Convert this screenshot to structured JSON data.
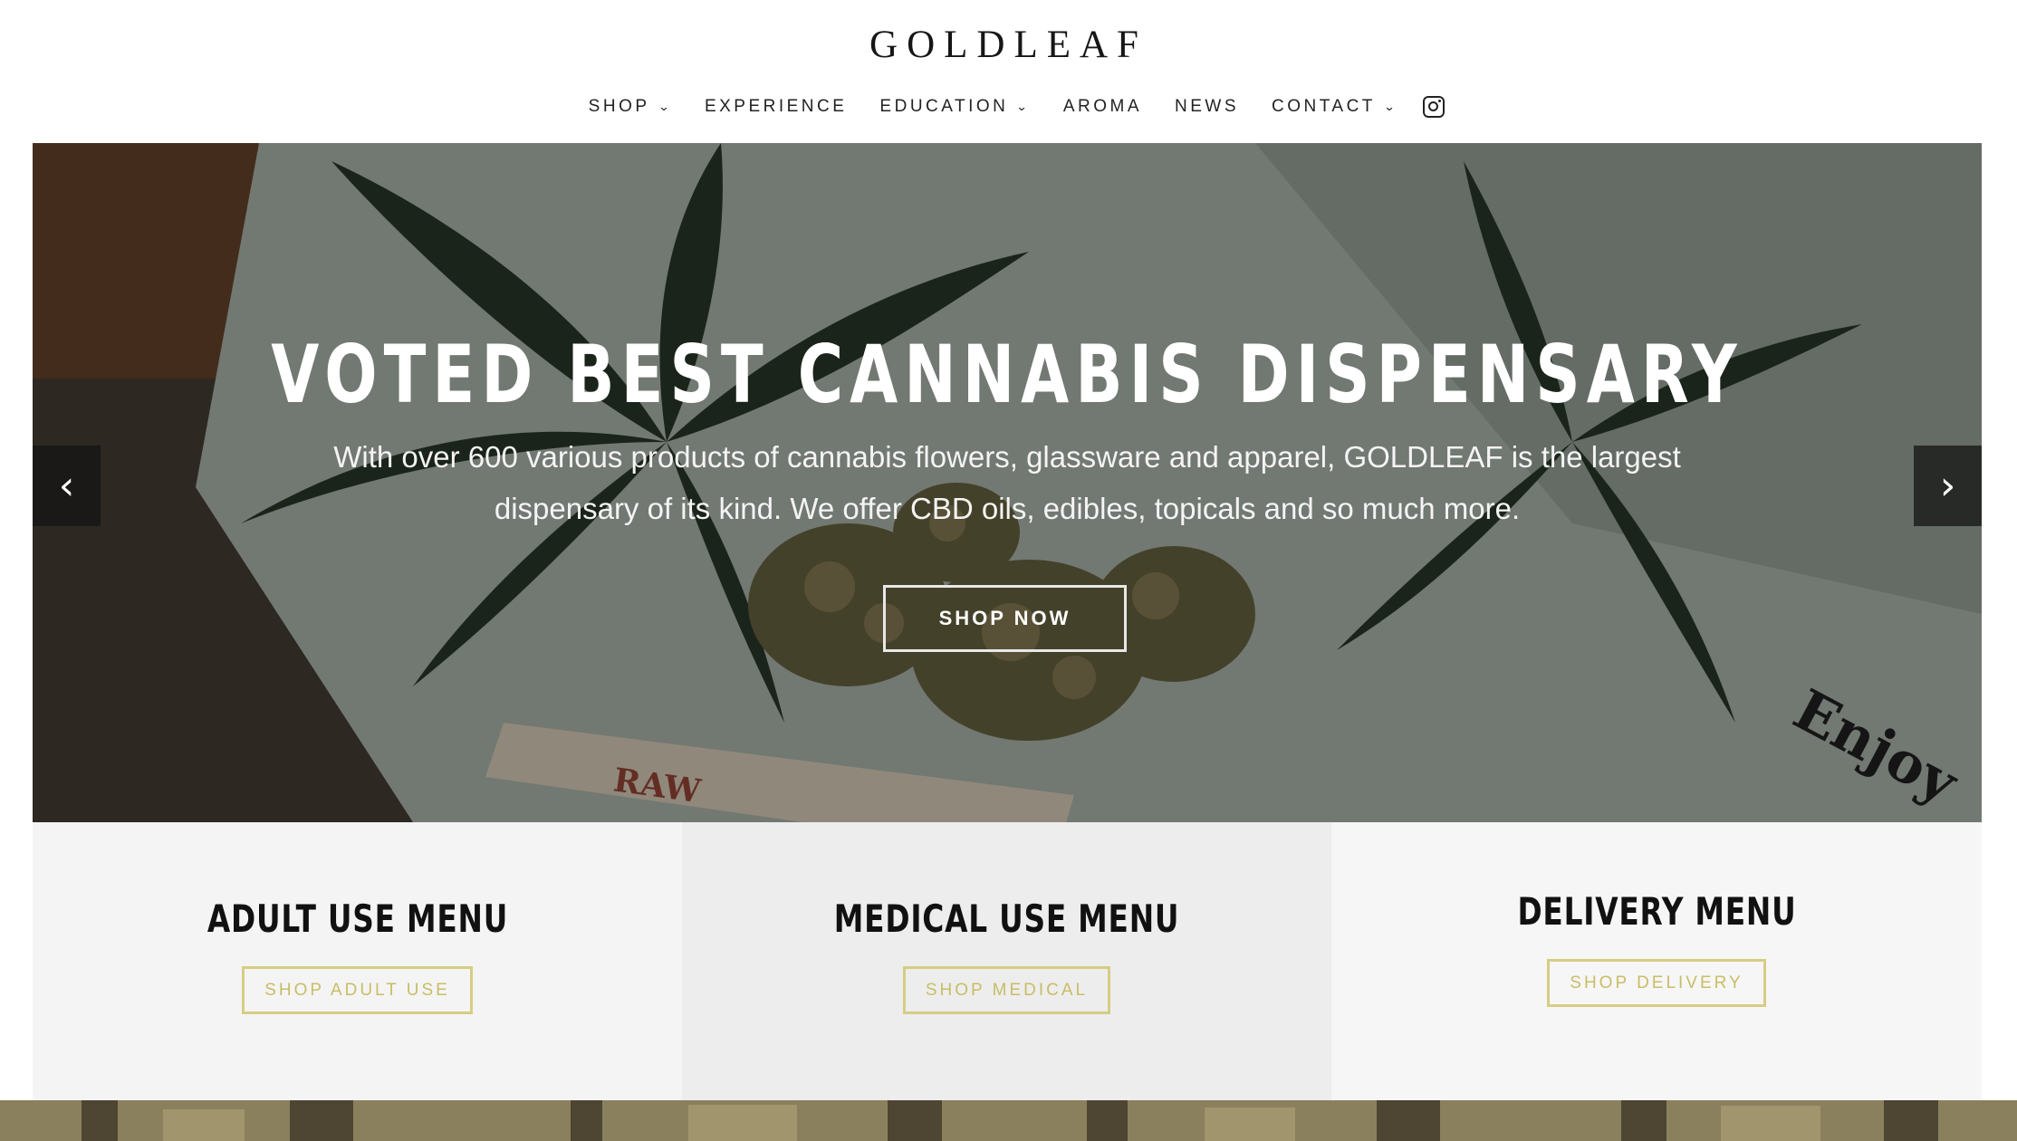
{
  "brand": {
    "logo": "GOLDLEAF"
  },
  "nav": {
    "items": [
      {
        "label": "SHOP",
        "dropdown": true
      },
      {
        "label": "EXPERIENCE",
        "dropdown": false
      },
      {
        "label": "EDUCATION",
        "dropdown": true
      },
      {
        "label": "AROMA",
        "dropdown": false
      },
      {
        "label": "NEWS",
        "dropdown": false
      },
      {
        "label": "CONTACT",
        "dropdown": true
      }
    ],
    "chevron": "⌄",
    "social_icon": "instagram-icon"
  },
  "hero": {
    "title": "VOTED BEST CANNABIS DISPENSARY",
    "subtitle": "With over 600 various products of cannabis flowers, glassware and apparel, GOLDLEAF is the largest dispensary of its kind. We offer CBD oils, edibles, topicals and so much more.",
    "cta": "SHOP NOW",
    "prev_arrow": "‹",
    "next_arrow": "›",
    "image_text": {
      "raw": "RAW",
      "card": "Enjoy"
    }
  },
  "menus": [
    {
      "title": "ADULT USE MENU",
      "button": "SHOP ADULT USE",
      "bg": "#f4f4f4"
    },
    {
      "title": "MEDICAL USE MENU",
      "button": "SHOP MEDICAL",
      "bg": "#ededed"
    },
    {
      "title": "DELIVERY MENU",
      "button": "SHOP DELIVERY",
      "bg": "#f6f6f6"
    }
  ],
  "colors": {
    "accent_gold": "#d6cd84",
    "text_dark": "#111111",
    "hero_overlay": "#000000"
  }
}
